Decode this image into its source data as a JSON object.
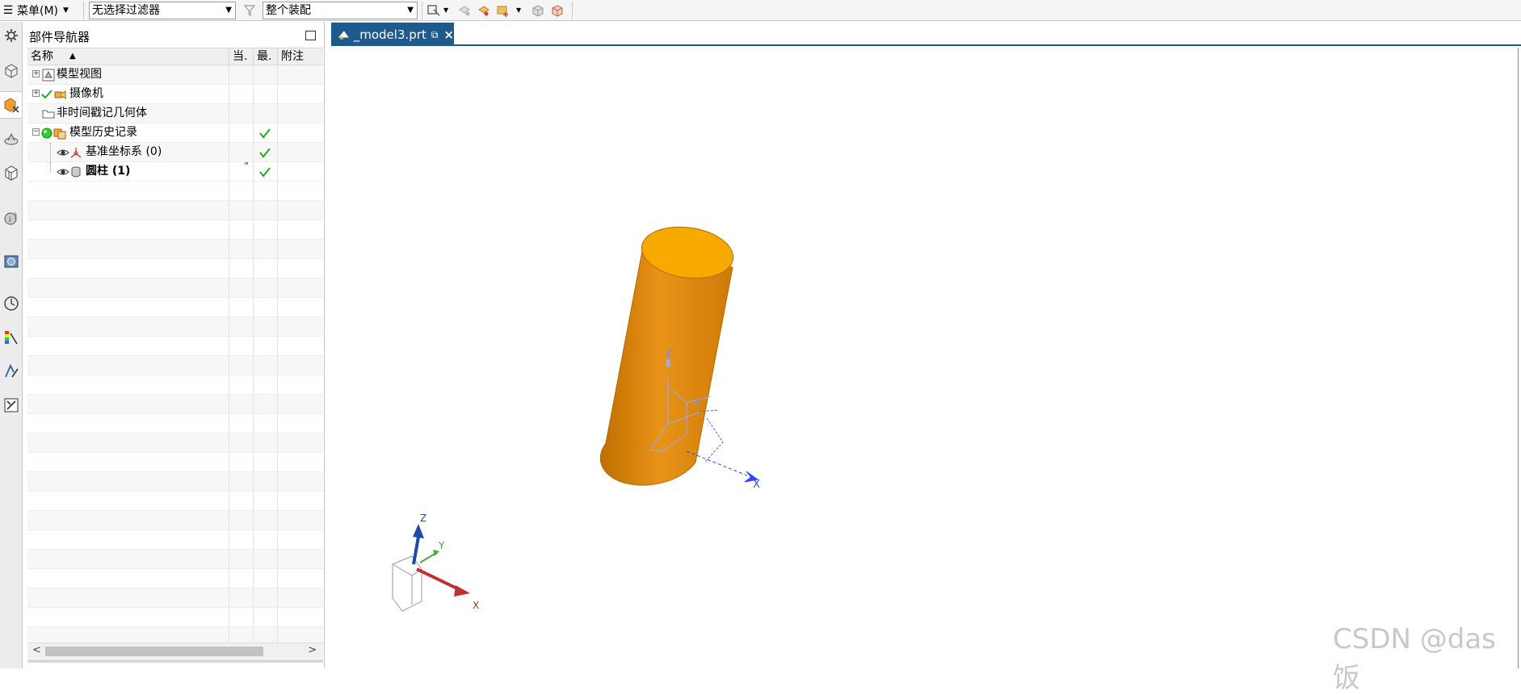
{
  "toolbar": {
    "menu_label": "菜单(M)",
    "selection_filter": "无选择过滤器",
    "assembly_scope": "整个装配",
    "icons": [
      "filter-icon",
      "snap-select-icon",
      "component-icon",
      "point-icon",
      "view-icon",
      "shaded-box-icon",
      "section-box-icon"
    ]
  },
  "resource_bar": {
    "icons": [
      "settings-icon",
      "assembly-navigator-icon",
      "part-navigator-icon",
      "constraint-navigator-icon",
      "reuse-library-icon",
      "hd3d-icon",
      "web-browser-icon",
      "history-icon",
      "visualization-icon",
      "process-studio-icon",
      "manufacturing-wizard-icon"
    ],
    "active": "part-navigator-icon"
  },
  "navigator": {
    "title": "部件导航器",
    "columns": [
      "名称",
      "当.",
      "最.",
      "附注"
    ],
    "rows": [
      {
        "label": "模型视图",
        "expander": "+",
        "current": "",
        "latest": false
      },
      {
        "label": "摄像机",
        "expander": "+",
        "current": "",
        "latest": false
      },
      {
        "label": "非时间戳记几何体",
        "expander": "",
        "current": "",
        "latest": false
      },
      {
        "label": "模型历史记录",
        "expander": "−",
        "current": "",
        "latest": true
      },
      {
        "label": "基准坐标系 (0)",
        "expander": "",
        "current": "",
        "latest": true
      },
      {
        "label": "圆柱 (1)",
        "expander": "",
        "current": "ᴱ",
        "latest": true
      }
    ],
    "empty_rows": 24
  },
  "viewport": {
    "tab_label": "_model3.prt",
    "part_color": "#e08a00",
    "part_top_color": "#f5a800",
    "csys_color": "#8fa0ff",
    "triad_labels": {
      "x": "X",
      "y": "Y",
      "z": "Z"
    }
  },
  "watermark": "CSDN @das饭"
}
